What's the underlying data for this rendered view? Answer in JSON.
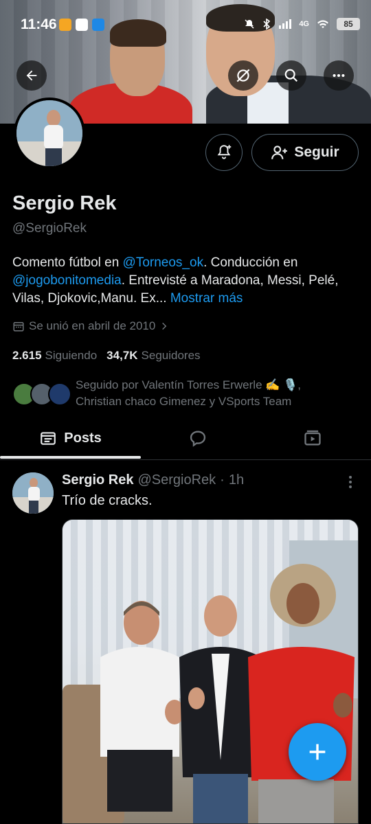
{
  "status_bar": {
    "time": "11:46",
    "network": "4G",
    "battery": "85"
  },
  "profile": {
    "name": "Sergio Rek",
    "handle": "@SergioRek",
    "follow_label": "Seguir",
    "bio": {
      "part1": "Comento fútbol en ",
      "mention1": "@Torneos_ok",
      "part2": ". Conducción en ",
      "mention2": "@jogobonitomedia",
      "part3": ". Entrevisté a Maradona, Messi, Pelé, Vilas, Djokovic,Manu. Ex...",
      "more": " Mostrar más"
    },
    "joined": "Se unió en abril de 2010",
    "following_count": "2.615",
    "following_label": "Siguiendo",
    "followers_count": "34,7K",
    "followers_label": "Seguidores",
    "followed_by_line1": "Seguido por Valentín Torres Erwerle ✍️ 🎙️,",
    "followed_by_line2": "Christian chaco Gimenez y VSports Team"
  },
  "tabs": [
    {
      "label": "Posts",
      "icon": "posts-icon",
      "active": true
    },
    {
      "label": "",
      "icon": "replies-icon",
      "active": false
    },
    {
      "label": "",
      "icon": "media-icon",
      "active": false
    }
  ],
  "post": {
    "author": "Sergio Rek",
    "handle": "@SergioRek",
    "separator": "·",
    "time": "1h",
    "text": "Trío de cracks."
  },
  "colors": {
    "accent": "#1d9bf0",
    "background": "#000000",
    "text": "#e7e9ea",
    "muted": "#71767b"
  }
}
